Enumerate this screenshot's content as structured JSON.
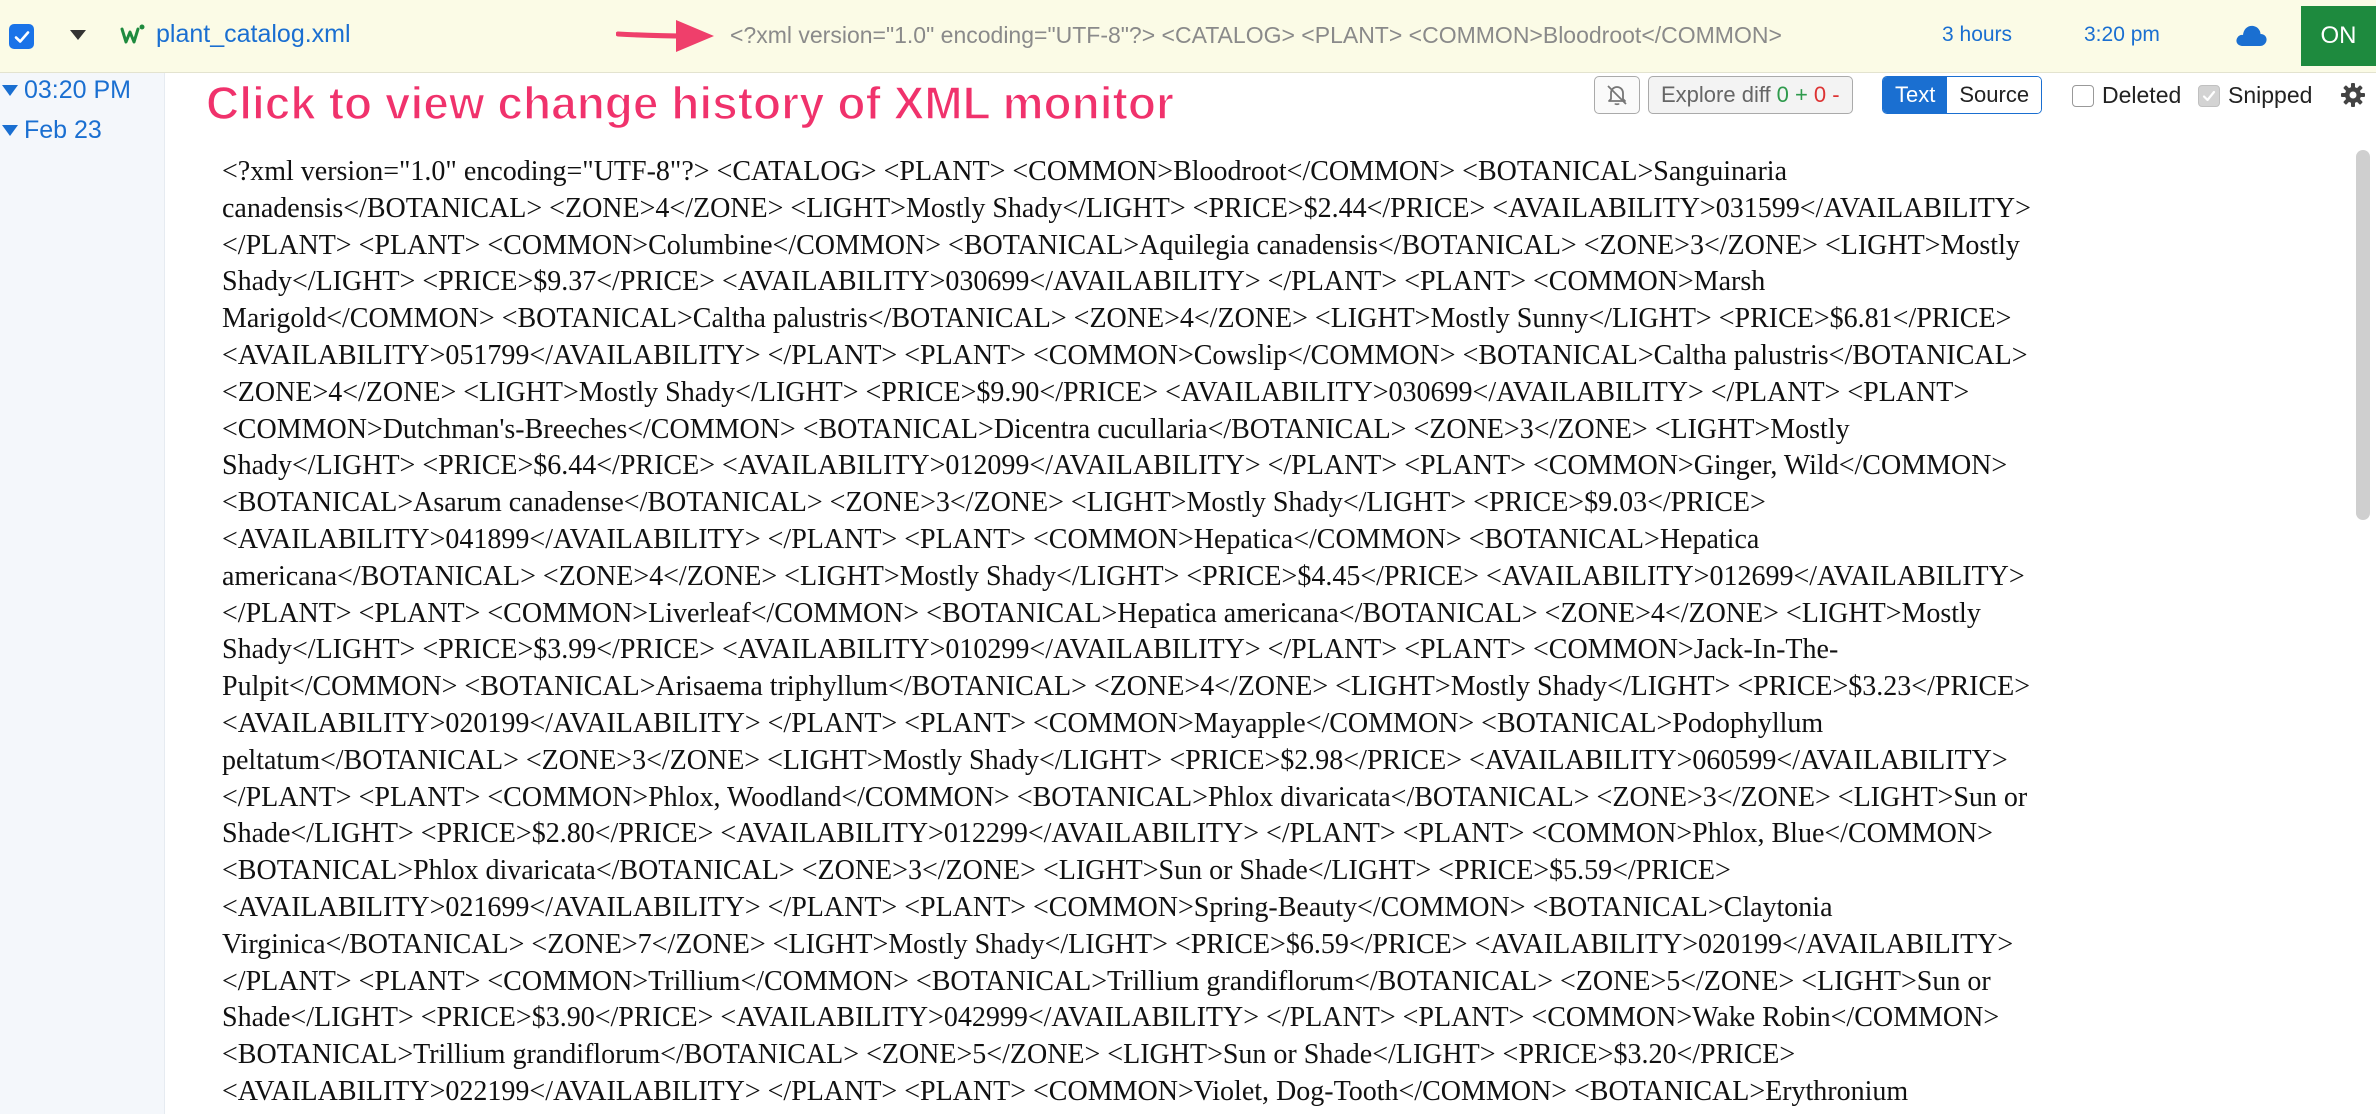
{
  "topbar": {
    "filename": "plant_catalog.xml",
    "preview": "<?xml version=\"1.0\" encoding=\"UTF-8\"?> <CATALOG> <PLANT> <COMMON>Bloodroot</COMMON>",
    "since": "3 hours",
    "time": "3:20 pm",
    "toggle_label": "ON"
  },
  "sidebar": {
    "entries": [
      {
        "label": "03:20 PM"
      },
      {
        "label": "Feb 23"
      }
    ]
  },
  "annotation": "Click to view change history of XML monitor",
  "toolbar": {
    "explore_diff": "Explore diff",
    "added": "0 +",
    "removed": "0 -",
    "view_text": "Text",
    "view_source": "Source",
    "deleted_label": "Deleted",
    "snipped_label": "Snipped"
  },
  "content": {
    "lines": [
      "<?xml version=\"1.0\" encoding=\"UTF-8\"?> <CATALOG> <PLANT> <COMMON>Bloodroot</COMMON> <BOTANICAL>Sanguinaria",
      "canadensis</BOTANICAL> <ZONE>4</ZONE> <LIGHT>Mostly Shady</LIGHT> <PRICE>$2.44</PRICE> <AVAILABILITY>031599</AVAILABILITY>",
      "</PLANT> <PLANT> <COMMON>Columbine</COMMON> <BOTANICAL>Aquilegia canadensis</BOTANICAL> <ZONE>3</ZONE> <LIGHT>Mostly",
      "Shady</LIGHT> <PRICE>$9.37</PRICE> <AVAILABILITY>030699</AVAILABILITY> </PLANT> <PLANT> <COMMON>Marsh",
      "Marigold</COMMON> <BOTANICAL>Caltha palustris</BOTANICAL> <ZONE>4</ZONE> <LIGHT>Mostly Sunny</LIGHT> <PRICE>$6.81</PRICE>",
      "<AVAILABILITY>051799</AVAILABILITY> </PLANT> <PLANT> <COMMON>Cowslip</COMMON> <BOTANICAL>Caltha palustris</BOTANICAL>",
      "<ZONE>4</ZONE> <LIGHT>Mostly Shady</LIGHT> <PRICE>$9.90</PRICE> <AVAILABILITY>030699</AVAILABILITY> </PLANT> <PLANT>",
      "<COMMON>Dutchman's-Breeches</COMMON> <BOTANICAL>Dicentra cucullaria</BOTANICAL> <ZONE>3</ZONE> <LIGHT>Mostly",
      "Shady</LIGHT> <PRICE>$6.44</PRICE> <AVAILABILITY>012099</AVAILABILITY> </PLANT> <PLANT> <COMMON>Ginger, Wild</COMMON>",
      "<BOTANICAL>Asarum canadense</BOTANICAL> <ZONE>3</ZONE> <LIGHT>Mostly Shady</LIGHT> <PRICE>$9.03</PRICE>",
      "<AVAILABILITY>041899</AVAILABILITY> </PLANT> <PLANT> <COMMON>Hepatica</COMMON> <BOTANICAL>Hepatica",
      "americana</BOTANICAL> <ZONE>4</ZONE> <LIGHT>Mostly Shady</LIGHT> <PRICE>$4.45</PRICE> <AVAILABILITY>012699</AVAILABILITY>",
      "</PLANT> <PLANT> <COMMON>Liverleaf</COMMON> <BOTANICAL>Hepatica americana</BOTANICAL> <ZONE>4</ZONE> <LIGHT>Mostly",
      "Shady</LIGHT> <PRICE>$3.99</PRICE> <AVAILABILITY>010299</AVAILABILITY> </PLANT> <PLANT> <COMMON>Jack-In-The-",
      "Pulpit</COMMON> <BOTANICAL>Arisaema triphyllum</BOTANICAL> <ZONE>4</ZONE> <LIGHT>Mostly Shady</LIGHT> <PRICE>$3.23</PRICE>",
      "<AVAILABILITY>020199</AVAILABILITY> </PLANT> <PLANT> <COMMON>Mayapple</COMMON> <BOTANICAL>Podophyllum",
      "peltatum</BOTANICAL> <ZONE>3</ZONE> <LIGHT>Mostly Shady</LIGHT> <PRICE>$2.98</PRICE> <AVAILABILITY>060599</AVAILABILITY>",
      "</PLANT> <PLANT> <COMMON>Phlox, Woodland</COMMON> <BOTANICAL>Phlox divaricata</BOTANICAL> <ZONE>3</ZONE> <LIGHT>Sun or",
      "Shade</LIGHT> <PRICE>$2.80</PRICE> <AVAILABILITY>012299</AVAILABILITY> </PLANT> <PLANT> <COMMON>Phlox, Blue</COMMON>",
      "<BOTANICAL>Phlox divaricata</BOTANICAL> <ZONE>3</ZONE> <LIGHT>Sun or Shade</LIGHT> <PRICE>$5.59</PRICE>",
      "<AVAILABILITY>021699</AVAILABILITY> </PLANT> <PLANT> <COMMON>Spring-Beauty</COMMON> <BOTANICAL>Claytonia",
      "Virginica</BOTANICAL> <ZONE>7</ZONE> <LIGHT>Mostly Shady</LIGHT> <PRICE>$6.59</PRICE> <AVAILABILITY>020199</AVAILABILITY>",
      "</PLANT> <PLANT> <COMMON>Trillium</COMMON> <BOTANICAL>Trillium grandiflorum</BOTANICAL> <ZONE>5</ZONE> <LIGHT>Sun or",
      "Shade</LIGHT> <PRICE>$3.90</PRICE> <AVAILABILITY>042999</AVAILABILITY> </PLANT> <PLANT> <COMMON>Wake Robin</COMMON>",
      "<BOTANICAL>Trillium grandiflorum</BOTANICAL> <ZONE>5</ZONE> <LIGHT>Sun or Shade</LIGHT> <PRICE>$3.20</PRICE>",
      "<AVAILABILITY>022199</AVAILABILITY> </PLANT> <PLANT> <COMMON>Violet, Dog-Tooth</COMMON> <BOTANICAL>Erythronium"
    ]
  },
  "colors": {
    "accent": "#1a6fd1",
    "on_button": "#1e8a3e",
    "annotation": "#f0326c",
    "arrow": "#ef3f6b",
    "topbar_bg": "#fbfbe6"
  },
  "icons": {
    "checkbox": "check-icon",
    "dropdown": "chevron-down-icon",
    "logo": "w-logo-icon",
    "arrow": "arrow-right-icon",
    "cloud": "cloud-icon",
    "bell": "bell-off-icon",
    "gear": "gear-icon"
  }
}
